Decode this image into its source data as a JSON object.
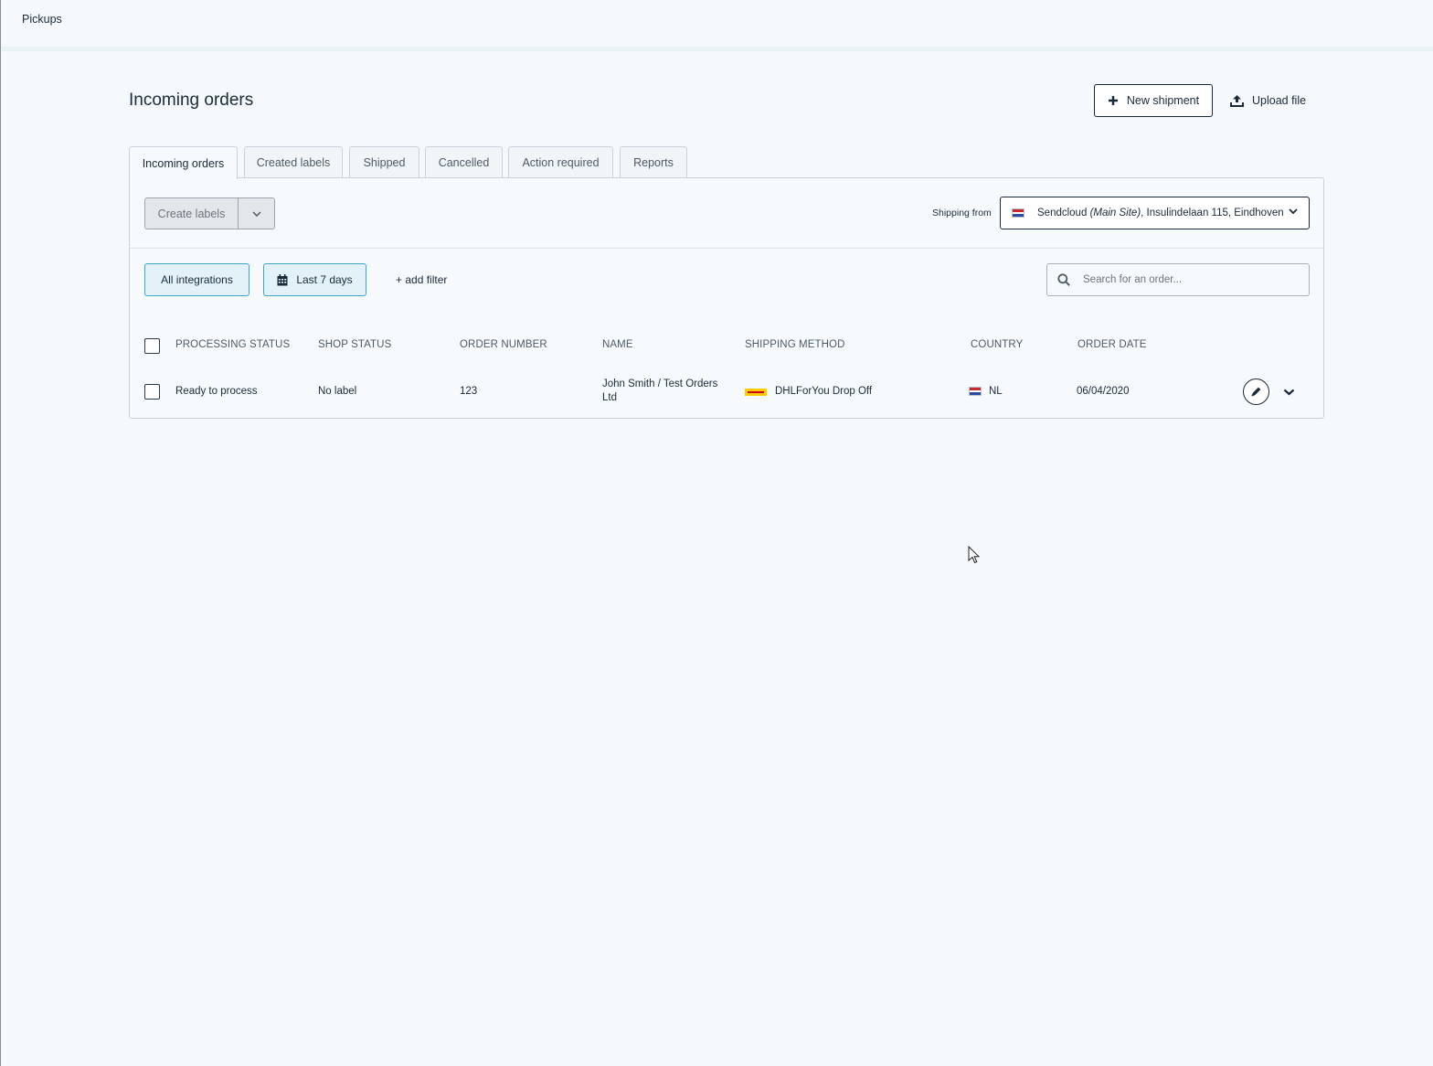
{
  "topbar": {
    "breadcrumb": "Pickups"
  },
  "header": {
    "title": "Incoming orders",
    "new_shipment_label": "New shipment",
    "upload_file_label": "Upload file"
  },
  "tabs": [
    {
      "label": "Incoming orders",
      "active": true
    },
    {
      "label": "Created labels",
      "active": false
    },
    {
      "label": "Shipped",
      "active": false
    },
    {
      "label": "Cancelled",
      "active": false
    },
    {
      "label": "Action required",
      "active": false
    },
    {
      "label": "Reports",
      "active": false
    }
  ],
  "toolbar": {
    "create_labels_label": "Create labels",
    "shipping_from_label": "Shipping from",
    "shipping_from": {
      "company": "Sendcloud",
      "site": "(Main Site)",
      "address": ", Insulindelaan 115, Eindhoven",
      "flag": "NL"
    }
  },
  "filters": {
    "integrations_label": "All integrations",
    "date_label": "Last 7 days",
    "add_filter_label": "+ add filter",
    "search_placeholder": "Search for an order..."
  },
  "table": {
    "columns": [
      "PROCESSING STATUS",
      "SHOP STATUS",
      "ORDER NUMBER",
      "NAME",
      "SHIPPING METHOD",
      "COUNTRY",
      "ORDER DATE"
    ],
    "rows": [
      {
        "processing_status": "Ready to process",
        "shop_status": "No label",
        "order_number": "123",
        "name_line1": "John Smith / Test Orders",
        "name_line2": "Ltd",
        "shipping_method": "DHLForYou Drop Off",
        "carrier_icon": "dhl-logo-icon",
        "country": "NL",
        "order_date": "06/04/2020"
      }
    ]
  },
  "colors": {
    "background": "#f5f9fc",
    "text": "#1b2a3a",
    "chip_border": "#3aa6c8",
    "chip_fill": "#e3f1f8",
    "dhl_yellow": "#ffcc00",
    "dhl_red": "#d40511"
  }
}
